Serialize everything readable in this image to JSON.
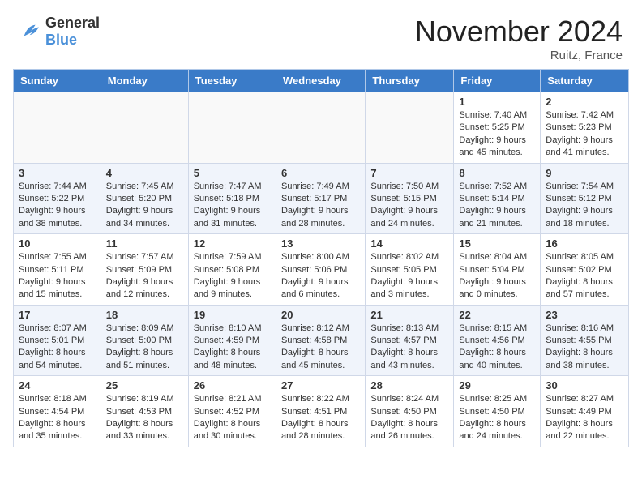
{
  "header": {
    "logo_general": "General",
    "logo_blue": "Blue",
    "month_title": "November 2024",
    "location": "Ruitz, France"
  },
  "calendar": {
    "days_of_week": [
      "Sunday",
      "Monday",
      "Tuesday",
      "Wednesday",
      "Thursday",
      "Friday",
      "Saturday"
    ],
    "weeks": [
      [
        {
          "day": "",
          "info": ""
        },
        {
          "day": "",
          "info": ""
        },
        {
          "day": "",
          "info": ""
        },
        {
          "day": "",
          "info": ""
        },
        {
          "day": "",
          "info": ""
        },
        {
          "day": "1",
          "info": "Sunrise: 7:40 AM\nSunset: 5:25 PM\nDaylight: 9 hours and 45 minutes."
        },
        {
          "day": "2",
          "info": "Sunrise: 7:42 AM\nSunset: 5:23 PM\nDaylight: 9 hours and 41 minutes."
        }
      ],
      [
        {
          "day": "3",
          "info": "Sunrise: 7:44 AM\nSunset: 5:22 PM\nDaylight: 9 hours and 38 minutes."
        },
        {
          "day": "4",
          "info": "Sunrise: 7:45 AM\nSunset: 5:20 PM\nDaylight: 9 hours and 34 minutes."
        },
        {
          "day": "5",
          "info": "Sunrise: 7:47 AM\nSunset: 5:18 PM\nDaylight: 9 hours and 31 minutes."
        },
        {
          "day": "6",
          "info": "Sunrise: 7:49 AM\nSunset: 5:17 PM\nDaylight: 9 hours and 28 minutes."
        },
        {
          "day": "7",
          "info": "Sunrise: 7:50 AM\nSunset: 5:15 PM\nDaylight: 9 hours and 24 minutes."
        },
        {
          "day": "8",
          "info": "Sunrise: 7:52 AM\nSunset: 5:14 PM\nDaylight: 9 hours and 21 minutes."
        },
        {
          "day": "9",
          "info": "Sunrise: 7:54 AM\nSunset: 5:12 PM\nDaylight: 9 hours and 18 minutes."
        }
      ],
      [
        {
          "day": "10",
          "info": "Sunrise: 7:55 AM\nSunset: 5:11 PM\nDaylight: 9 hours and 15 minutes."
        },
        {
          "day": "11",
          "info": "Sunrise: 7:57 AM\nSunset: 5:09 PM\nDaylight: 9 hours and 12 minutes."
        },
        {
          "day": "12",
          "info": "Sunrise: 7:59 AM\nSunset: 5:08 PM\nDaylight: 9 hours and 9 minutes."
        },
        {
          "day": "13",
          "info": "Sunrise: 8:00 AM\nSunset: 5:06 PM\nDaylight: 9 hours and 6 minutes."
        },
        {
          "day": "14",
          "info": "Sunrise: 8:02 AM\nSunset: 5:05 PM\nDaylight: 9 hours and 3 minutes."
        },
        {
          "day": "15",
          "info": "Sunrise: 8:04 AM\nSunset: 5:04 PM\nDaylight: 9 hours and 0 minutes."
        },
        {
          "day": "16",
          "info": "Sunrise: 8:05 AM\nSunset: 5:02 PM\nDaylight: 8 hours and 57 minutes."
        }
      ],
      [
        {
          "day": "17",
          "info": "Sunrise: 8:07 AM\nSunset: 5:01 PM\nDaylight: 8 hours and 54 minutes."
        },
        {
          "day": "18",
          "info": "Sunrise: 8:09 AM\nSunset: 5:00 PM\nDaylight: 8 hours and 51 minutes."
        },
        {
          "day": "19",
          "info": "Sunrise: 8:10 AM\nSunset: 4:59 PM\nDaylight: 8 hours and 48 minutes."
        },
        {
          "day": "20",
          "info": "Sunrise: 8:12 AM\nSunset: 4:58 PM\nDaylight: 8 hours and 45 minutes."
        },
        {
          "day": "21",
          "info": "Sunrise: 8:13 AM\nSunset: 4:57 PM\nDaylight: 8 hours and 43 minutes."
        },
        {
          "day": "22",
          "info": "Sunrise: 8:15 AM\nSunset: 4:56 PM\nDaylight: 8 hours and 40 minutes."
        },
        {
          "day": "23",
          "info": "Sunrise: 8:16 AM\nSunset: 4:55 PM\nDaylight: 8 hours and 38 minutes."
        }
      ],
      [
        {
          "day": "24",
          "info": "Sunrise: 8:18 AM\nSunset: 4:54 PM\nDaylight: 8 hours and 35 minutes."
        },
        {
          "day": "25",
          "info": "Sunrise: 8:19 AM\nSunset: 4:53 PM\nDaylight: 8 hours and 33 minutes."
        },
        {
          "day": "26",
          "info": "Sunrise: 8:21 AM\nSunset: 4:52 PM\nDaylight: 8 hours and 30 minutes."
        },
        {
          "day": "27",
          "info": "Sunrise: 8:22 AM\nSunset: 4:51 PM\nDaylight: 8 hours and 28 minutes."
        },
        {
          "day": "28",
          "info": "Sunrise: 8:24 AM\nSunset: 4:50 PM\nDaylight: 8 hours and 26 minutes."
        },
        {
          "day": "29",
          "info": "Sunrise: 8:25 AM\nSunset: 4:50 PM\nDaylight: 8 hours and 24 minutes."
        },
        {
          "day": "30",
          "info": "Sunrise: 8:27 AM\nSunset: 4:49 PM\nDaylight: 8 hours and 22 minutes."
        }
      ]
    ]
  }
}
